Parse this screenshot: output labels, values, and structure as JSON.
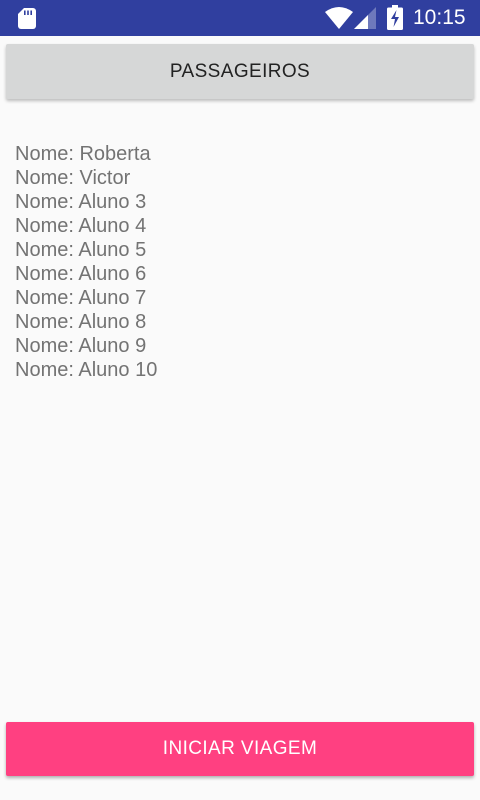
{
  "status_bar": {
    "time": "10:15",
    "icons": [
      "sd-card-icon",
      "wifi-icon",
      "cell-signal-icon",
      "battery-charging-icon"
    ],
    "background_color": "#303f9f"
  },
  "header_button": {
    "label": "PASSAGEIROS"
  },
  "passengers": [
    "Nome: Roberta",
    "Nome: Victor",
    "Nome: Aluno 3",
    "Nome: Aluno 4",
    "Nome: Aluno 5",
    "Nome: Aluno 6",
    "Nome: Aluno 7",
    "Nome: Aluno 8",
    "Nome: Aluno 9",
    "Nome: Aluno 10"
  ],
  "footer_button": {
    "label": "INICIAR VIAGEM",
    "color": "#ff4081"
  }
}
